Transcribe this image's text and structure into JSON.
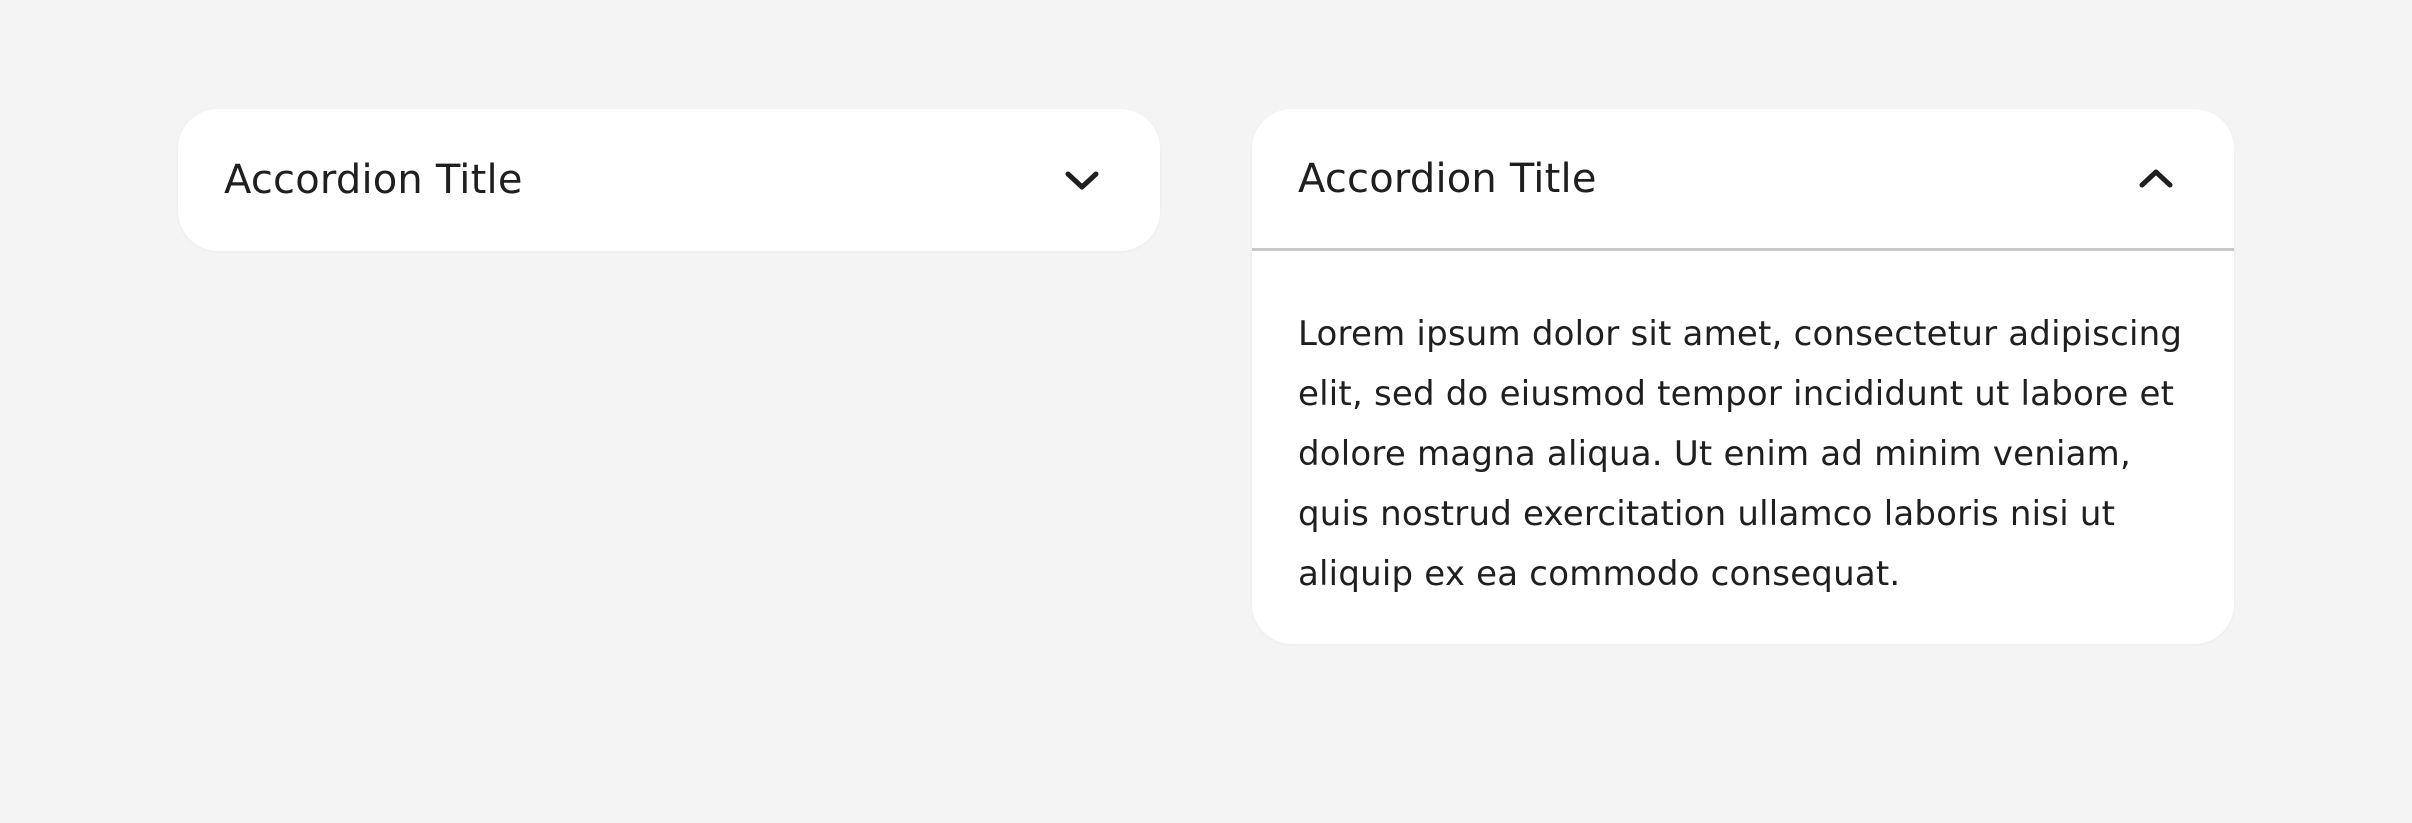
{
  "accordions": [
    {
      "title": "Accordion Title",
      "state": "collapsed",
      "icon": "chevron-down-icon"
    },
    {
      "title": "Accordion Title",
      "state": "expanded",
      "icon": "chevron-up-icon",
      "content": "Lorem ipsum dolor sit amet, consectetur adipiscing elit, sed do eiusmod tempor incididunt ut labore et dolore magna aliqua. Ut enim ad minim veniam, quis nostrud exercitation ullamco laboris nisi ut aliquip ex ea commodo consequat."
    }
  ],
  "colors": {
    "background": "#f4f4f4",
    "card": "#ffffff",
    "text": "#1f1f1f",
    "divider": "#c8c8c8"
  }
}
